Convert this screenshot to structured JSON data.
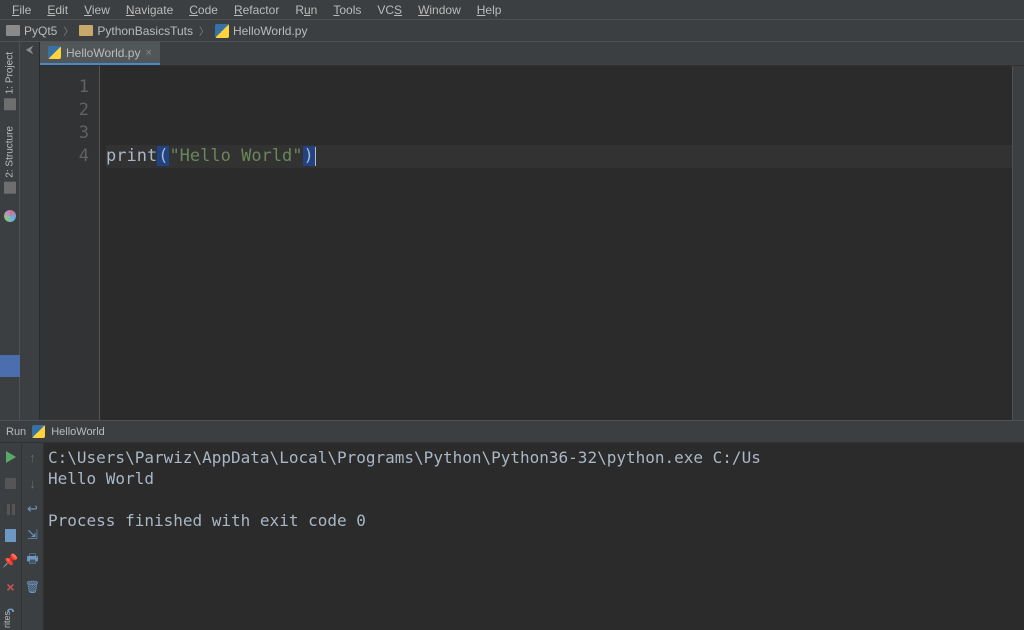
{
  "menu": {
    "file": "File",
    "edit": "Edit",
    "view": "View",
    "navigate": "Navigate",
    "code": "Code",
    "refactor": "Refactor",
    "run": "Run",
    "tools": "Tools",
    "vcs": "VCS",
    "window": "Window",
    "help": "Help"
  },
  "breadcrumb": {
    "project": "PyQt5",
    "folder": "PythonBasicsTuts",
    "file": "HelloWorld.py"
  },
  "sidebars": {
    "project_tab": "1: Project",
    "structure_tab": "2: Structure",
    "favorites": "rites"
  },
  "editor": {
    "tab_label": "HelloWorld.py",
    "line_numbers": [
      "1",
      "2",
      "3",
      "4"
    ],
    "line4": {
      "print": "print",
      "open": "(",
      "string": "\"Hello World\"",
      "close": ")"
    }
  },
  "run": {
    "header_label": "Run",
    "config_name": "HelloWorld",
    "console_line1": "C:\\Users\\Parwiz\\AppData\\Local\\Programs\\Python\\Python36-32\\python.exe C:/Us",
    "console_line2": "Hello World",
    "console_line3": "",
    "console_line4": "Process finished with exit code 0"
  }
}
